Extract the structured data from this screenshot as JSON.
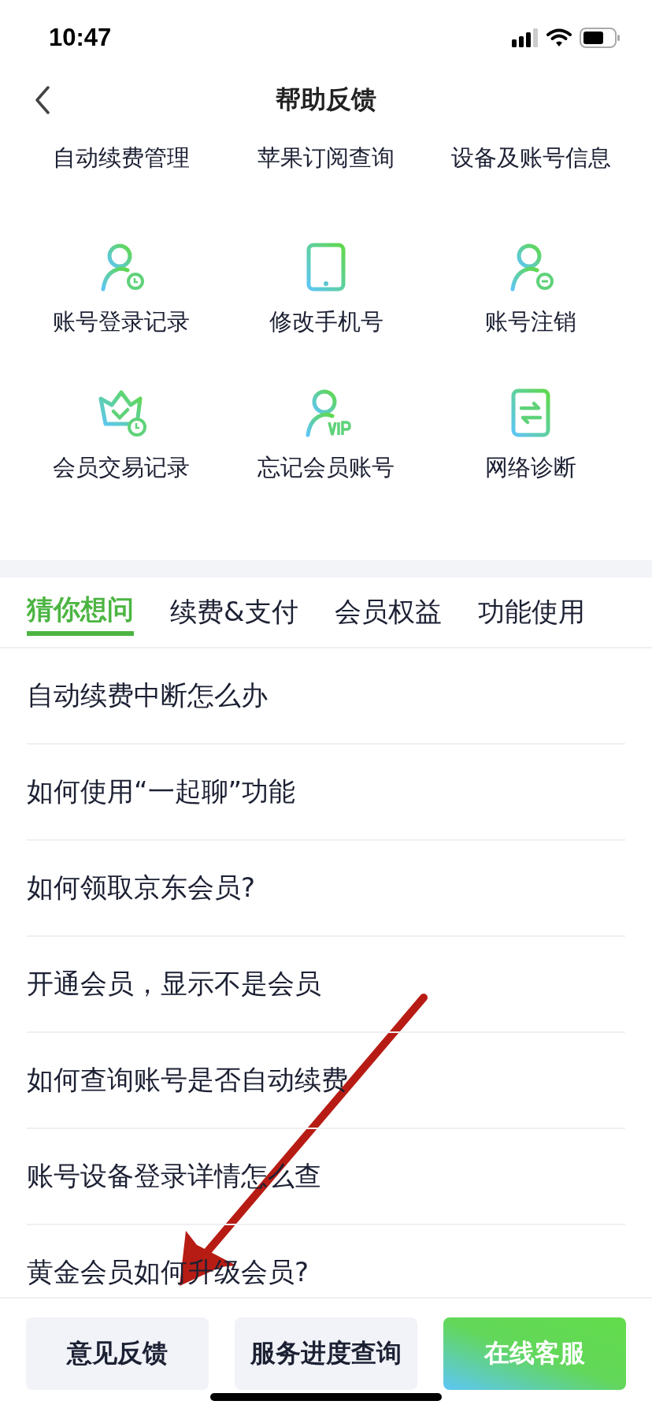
{
  "status_bar": {
    "time": "10:47"
  },
  "nav": {
    "title": "帮助反馈"
  },
  "shortcuts": [
    {
      "label": "自动续费管理",
      "icon_hidden": true
    },
    {
      "label": "苹果订阅查询",
      "icon_hidden": true
    },
    {
      "label": "设备及账号信息",
      "icon_hidden": true
    },
    {
      "label": "账号登录记录",
      "icon_hidden": false
    },
    {
      "label": "修改手机号",
      "icon_hidden": false
    },
    {
      "label": "账号注销",
      "icon_hidden": false
    },
    {
      "label": "会员交易记录",
      "icon_hidden": false
    },
    {
      "label": "忘记会员账号",
      "icon_hidden": false
    },
    {
      "label": "网络诊断",
      "icon_hidden": false
    }
  ],
  "tabs": [
    {
      "label": "猜你想问",
      "selected": true
    },
    {
      "label": "续费&支付",
      "selected": false
    },
    {
      "label": "会员权益",
      "selected": false
    },
    {
      "label": "功能使用",
      "selected": false
    }
  ],
  "questions": [
    "自动续费中断怎么办",
    "如何使用“一起聊”功能",
    "如何领取京东会员?",
    "开通会员，显示不是会员",
    "如何查询账号是否自动续费",
    "账号设备登录详情怎么查",
    "黄金会员如何升级会员?"
  ],
  "bottom_buttons": [
    {
      "label": "意见反馈",
      "kind": "plain"
    },
    {
      "label": "服务进度查询",
      "kind": "plain"
    },
    {
      "label": "在线客服",
      "kind": "primary"
    }
  ],
  "annotation": {
    "kind": "arrow"
  }
}
